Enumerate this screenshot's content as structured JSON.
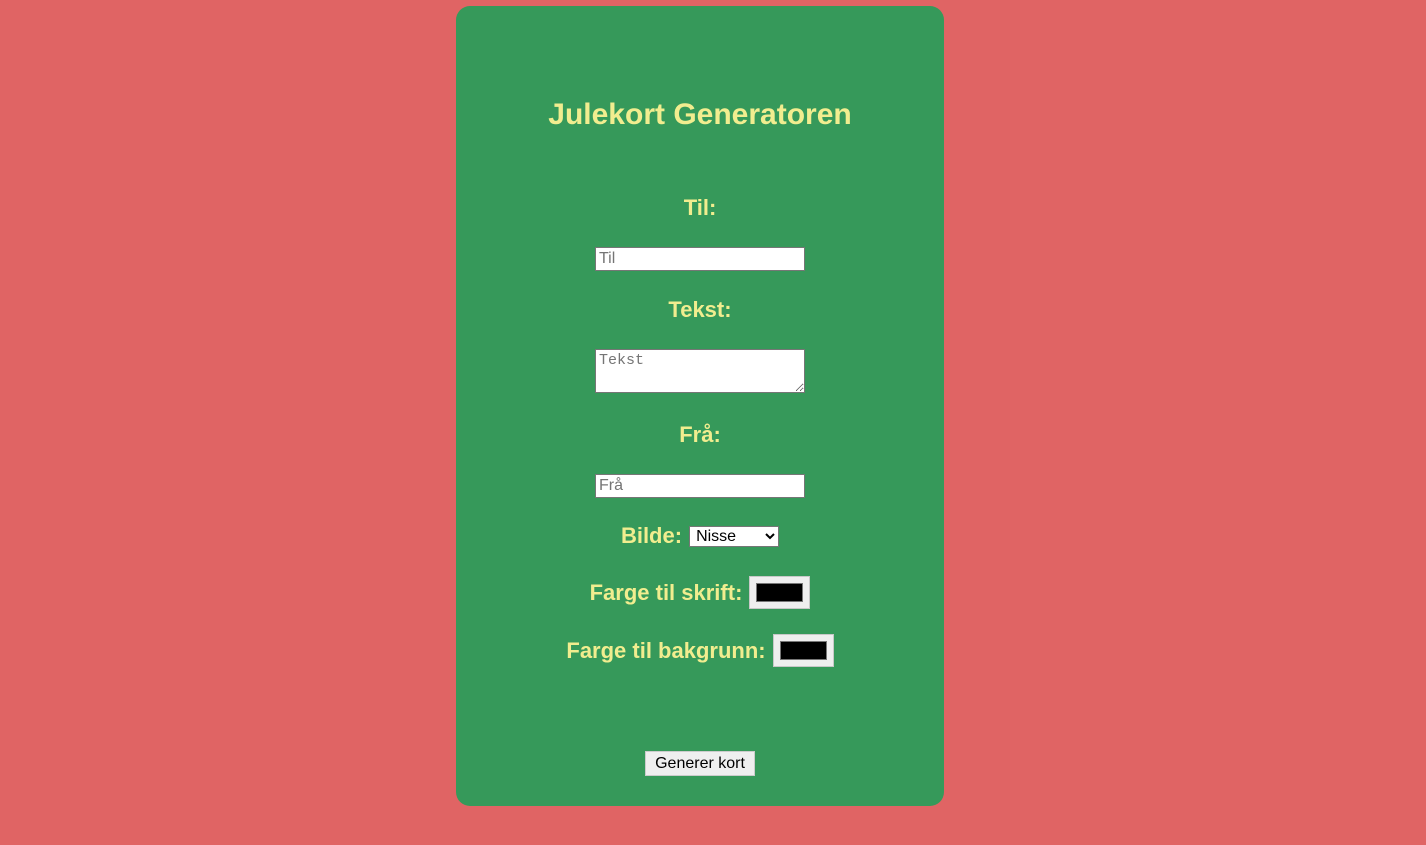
{
  "title": "Julekort Generatoren",
  "to": {
    "label": "Til:",
    "placeholder": "Til",
    "value": ""
  },
  "text": {
    "label": "Tekst:",
    "placeholder": "Tekst",
    "value": ""
  },
  "from": {
    "label": "Frå:",
    "placeholder": "Frå",
    "value": ""
  },
  "image": {
    "label": "Bilde:",
    "selected": "Nisse"
  },
  "font_color": {
    "label": "Farge til skrift:",
    "value": "#000000"
  },
  "bg_color": {
    "label": "Farge til bakgrunn:",
    "value": "#000000"
  },
  "generate_button": "Generer kort",
  "colors": {
    "page_background": "#e06464",
    "card_background": "#36995a",
    "text_accent": "#f1ed8f"
  }
}
